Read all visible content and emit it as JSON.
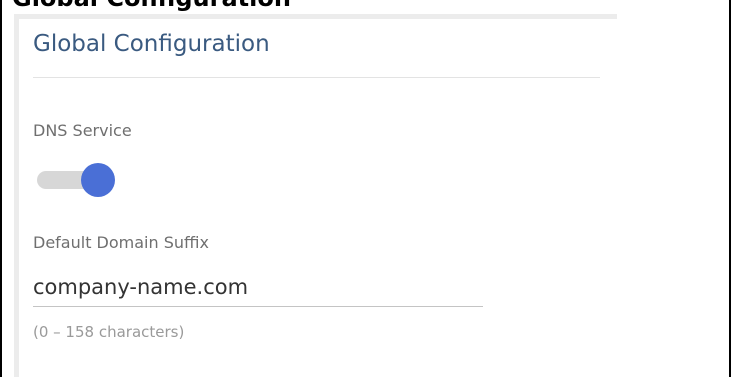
{
  "page": {
    "heading": "Global Configuration"
  },
  "panel": {
    "title": "Global Configuration",
    "dns_service": {
      "label": "DNS Service",
      "enabled": true
    },
    "default_domain_suffix": {
      "label": "Default Domain Suffix",
      "value": "company-name.com",
      "hint": "(0 – 158 characters)"
    }
  },
  "colors": {
    "title": "#3a5a80",
    "toggle_on": "#4a6fd6",
    "toggle_track": "#d7d7d7"
  }
}
